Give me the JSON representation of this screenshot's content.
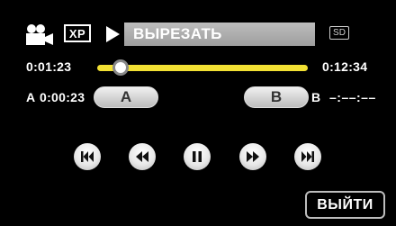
{
  "header": {
    "mode_icon": "video-camera-icon",
    "quality_badge": "XP",
    "status_icon": "play-icon",
    "title": "ВЫРЕЗАТЬ",
    "media_badge": "SD"
  },
  "timeline": {
    "current_time": "0:01:23",
    "total_time": "0:12:34",
    "position_fraction": 0.11
  },
  "ab": {
    "a_label": "A",
    "a_time": "0:00:23",
    "a_button": "A",
    "b_button": "B",
    "b_label": "B",
    "b_time": "–:––:––"
  },
  "transport": [
    {
      "name": "skip-back-button",
      "icon": "skip-to-start-icon"
    },
    {
      "name": "rewind-button",
      "icon": "rewind-icon"
    },
    {
      "name": "pause-button",
      "icon": "pause-icon"
    },
    {
      "name": "fast-forward-button",
      "icon": "fast-forward-icon"
    },
    {
      "name": "skip-forward-button",
      "icon": "skip-to-end-icon"
    }
  ],
  "exit_label": "ВЫЙТИ",
  "colors": {
    "background": "#000000",
    "slider": "#f2e033",
    "title_bar": "#a8a8a8",
    "button": "#e8e8e8"
  }
}
